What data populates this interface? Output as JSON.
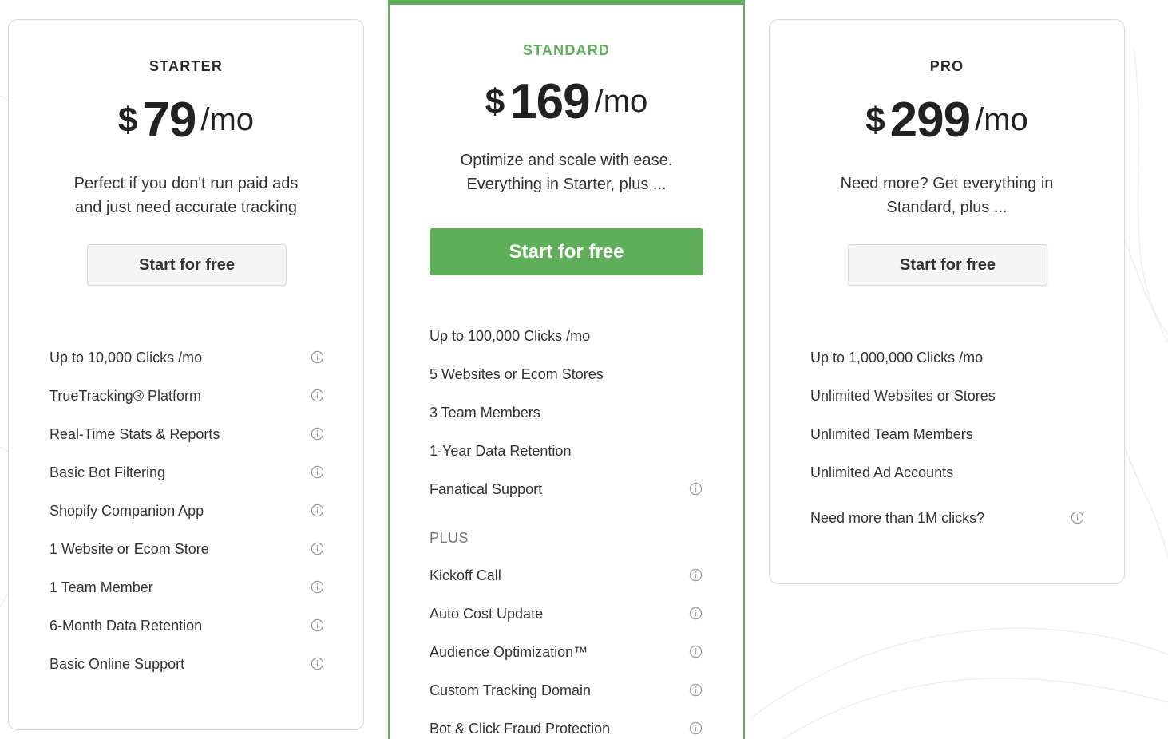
{
  "plans": [
    {
      "id": "starter",
      "name": "STARTER",
      "currency": "$",
      "amount": "79",
      "period": "/mo",
      "description_line1": "Perfect if you don't run paid ads",
      "description_line2": "and just need accurate tracking",
      "cta": "Start for free",
      "features": [
        {
          "label": "Up to 10,000 Clicks /mo",
          "info": true
        },
        {
          "label": "TrueTracking® Platform",
          "info": true
        },
        {
          "label": "Real-Time Stats & Reports",
          "info": true
        },
        {
          "label": "Basic Bot Filtering",
          "info": true
        },
        {
          "label": "Shopify Companion App",
          "info": true
        },
        {
          "label": "1 Website or Ecom Store",
          "info": true
        },
        {
          "label": "1 Team Member",
          "info": true
        },
        {
          "label": "6-Month Data Retention",
          "info": true
        },
        {
          "label": "Basic Online Support",
          "info": true
        }
      ]
    },
    {
      "id": "standard",
      "name": "STANDARD",
      "currency": "$",
      "amount": "169",
      "period": "/mo",
      "description_line1": "Optimize and scale with ease.",
      "description_line2": "Everything in Starter, plus ...",
      "cta": "Start for free",
      "features": [
        {
          "label": "Up to 100,000 Clicks /mo",
          "info": false
        },
        {
          "label": "5 Websites or Ecom Stores",
          "info": false
        },
        {
          "label": "3 Team Members",
          "info": false
        },
        {
          "label": "1-Year Data Retention",
          "info": false
        },
        {
          "label": "Fanatical Support",
          "info": true
        }
      ],
      "plus_label": "PLUS",
      "plus_features": [
        {
          "label": "Kickoff Call",
          "info": true
        },
        {
          "label": "Auto Cost Update",
          "info": true
        },
        {
          "label": "Audience Optimization™",
          "info": true
        },
        {
          "label": "Custom Tracking Domain",
          "info": true
        },
        {
          "label": "Bot & Click Fraud Protection",
          "info": true
        }
      ]
    },
    {
      "id": "pro",
      "name": "PRO",
      "currency": "$",
      "amount": "299",
      "period": "/mo",
      "description_line1": "Need more? Get everything in",
      "description_line2": "Standard, plus ...",
      "cta": "Start for free",
      "features": [
        {
          "label": "Up to 1,000,000 Clicks /mo",
          "info": false
        },
        {
          "label": "Unlimited Websites or Stores",
          "info": false
        },
        {
          "label": "Unlimited Team Members",
          "info": false
        },
        {
          "label": "Unlimited Ad Accounts",
          "info": false
        },
        {
          "label": "Need more than 1M clicks?",
          "info": true
        }
      ]
    }
  ],
  "colors": {
    "accent": "#5fae5a",
    "text": "#333333",
    "border": "#d9d9d9",
    "icon": "#9a9a9a"
  },
  "icons": {
    "feature_info": "info-circle-icon"
  }
}
